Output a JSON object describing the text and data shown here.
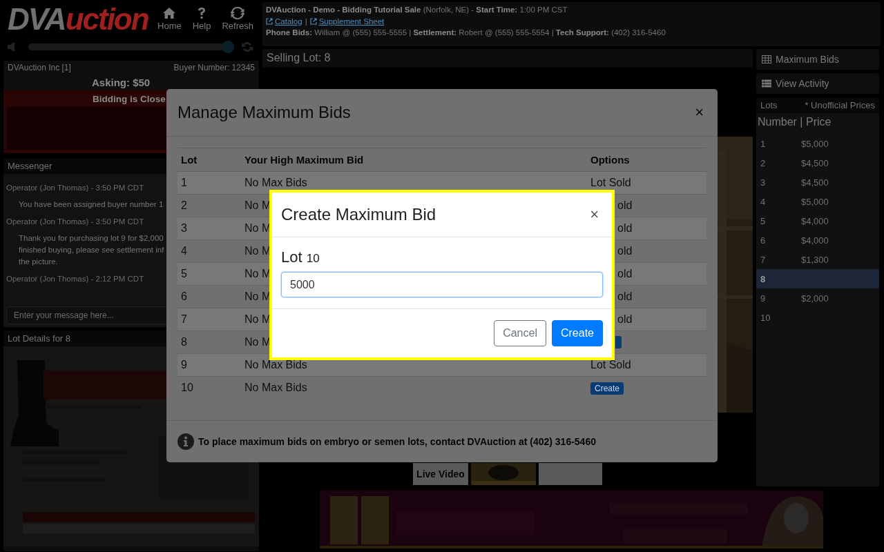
{
  "header": {
    "logo": [
      {
        "text": "DVA",
        "color": "#707070"
      },
      {
        "text": "uction",
        "color": "#a02020"
      }
    ],
    "nav": [
      {
        "kind": "home",
        "label": "Home"
      },
      {
        "kind": "help",
        "label": "Help"
      },
      {
        "kind": "refresh",
        "label": "Refresh"
      }
    ],
    "volume": {
      "level": 0.97
    }
  },
  "sale_info": {
    "title": "**DVAuction - Demo - Bidding Tutorial Sale** (Norfolk, NE) - **Start Time:** 1:00 PM CST",
    "links": [
      "Catalog",
      "Supplement Sheet"
    ],
    "separator": "|",
    "contacts": "**Phone Bids:** William @ (555) 555-5555 | **Settlement:** Robert @ (555) 555-5554 | **Tech Support:** (402) 316-5460"
  },
  "account": {
    "name": "DVAuction Inc [1]",
    "buyer_number": "Buyer Number: 12345",
    "asking": "Asking: $50",
    "status": "Bidding is Close"
  },
  "messenger": {
    "title": "Messenger",
    "messages": [
      {
        "kind": "meta",
        "lines": [
          "Operator (Jon Thomas) - 3:50 PM CDT"
        ]
      },
      {
        "kind": "message",
        "lines": [
          "You have been assigned buyer number 1"
        ]
      },
      {
        "kind": "meta",
        "lines": [
          "Operator (Jon Thomas) - 3:50 PM CDT"
        ]
      },
      {
        "kind": "message",
        "lines": [
          "Thank you for purchasing lot 9 for $2,000",
          "finished buying, please see settlement inf",
          "the picture."
        ]
      },
      {
        "kind": "meta",
        "lines": [
          "Operator (Jon Thomas) - 2:12 PM CDT"
        ]
      }
    ],
    "placeholder": "Enter your message here..."
  },
  "lot_details": {
    "title": "Lot Details for 8"
  },
  "selling_lot": "Selling Lot: 8",
  "video_tabs": [
    {
      "kind": "label",
      "label": "Live Video"
    },
    {
      "kind": "picture"
    },
    {
      "kind": "blank"
    }
  ],
  "side_buttons": [
    {
      "kind": "table",
      "label": "Maximum Bids"
    },
    {
      "kind": "list",
      "label": "View Activity"
    }
  ],
  "lots": {
    "title": "Lots",
    "note": "* Unofficial Prices",
    "heading": "Number | Price",
    "rows": [
      {
        "number": "1",
        "price": "$5,000",
        "selected": false
      },
      {
        "number": "2",
        "price": "$4,500",
        "selected": false
      },
      {
        "number": "3",
        "price": "$4,500",
        "selected": false
      },
      {
        "number": "4",
        "price": "$5,000",
        "selected": false
      },
      {
        "number": "5",
        "price": "$4,000",
        "selected": false
      },
      {
        "number": "6",
        "price": "$4,000",
        "selected": false
      },
      {
        "number": "7",
        "price": "$1,300",
        "selected": false
      },
      {
        "number": "8",
        "selected": true
      },
      {
        "number": "9",
        "price": "$2,000",
        "selected": false
      },
      {
        "number": "10",
        "selected": false
      }
    ]
  },
  "manage_modal": {
    "title": "Manage Maximum Bids",
    "close": "×",
    "columns": [
      "Lot",
      "Your High Maximum Bid",
      "Options"
    ],
    "rows": [
      {
        "lot": "1",
        "bid": "No Max Bids",
        "option": {
          "kind": "text",
          "text": "Lot Sold"
        }
      },
      {
        "lot": "2",
        "bid": "No M",
        "option": {
          "kind": "partial",
          "text": "old"
        }
      },
      {
        "lot": "3",
        "bid": "No M",
        "option": {
          "kind": "partial",
          "text": "old"
        }
      },
      {
        "lot": "4",
        "bid": "No M",
        "option": {
          "kind": "partial",
          "text": "old"
        }
      },
      {
        "lot": "5",
        "bid": "No M",
        "option": {
          "kind": "partial",
          "text": "old"
        }
      },
      {
        "lot": "6",
        "bid": "No M",
        "option": {
          "kind": "partial",
          "text": "old"
        }
      },
      {
        "lot": "7",
        "bid": "No M",
        "option": {
          "kind": "partial",
          "text": "old"
        }
      },
      {
        "lot": "8",
        "bid": "No M",
        "option": {
          "kind": "button_edge"
        }
      },
      {
        "lot": "9",
        "bid": "No Max Bids",
        "option": {
          "kind": "text",
          "text": "Lot Sold"
        }
      },
      {
        "lot": "10",
        "bid": "No Max Bids",
        "option": {
          "kind": "button",
          "text": "Create"
        }
      }
    ],
    "footer": "To place maximum bids on embryo or semen lots, contact DVAuction at (402) 316-5460"
  },
  "create_modal": {
    "title": "Create Maximum Bid",
    "close": "×",
    "lot_label": "Lot",
    "lot_number": "10",
    "value": "5000",
    "buttons": [
      {
        "kind": "secondary",
        "label": "Cancel"
      },
      {
        "kind": "primary",
        "label": "Create"
      }
    ]
  }
}
